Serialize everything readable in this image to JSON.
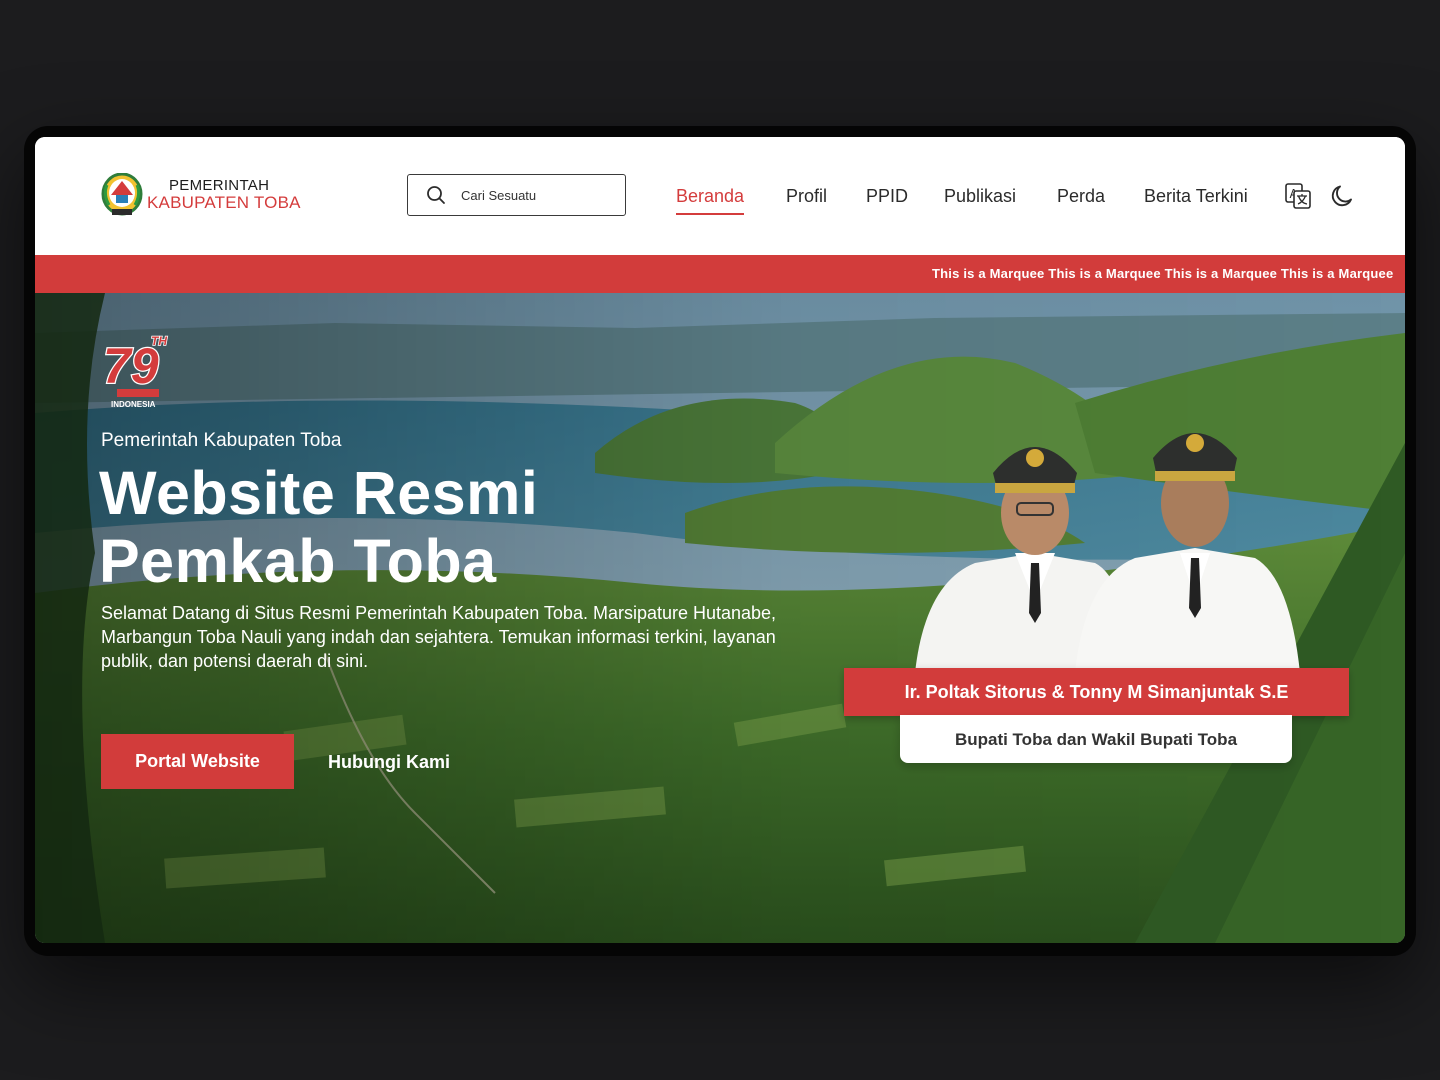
{
  "header": {
    "logo_line1": "PEMERINTAH",
    "logo_line2": "KABUPATEN TOBA",
    "search_placeholder": "Cari Sesuatu",
    "nav": [
      {
        "label": "Beranda",
        "active": true
      },
      {
        "label": "Profil"
      },
      {
        "label": "PPID"
      },
      {
        "label": "Publikasi"
      },
      {
        "label": "Perda"
      },
      {
        "label": "Berita Terkini"
      }
    ],
    "icons": [
      "translate-icon",
      "moon-icon"
    ]
  },
  "marquee": {
    "text": "This is a Marquee This is a Marquee This is a Marquee This is a Marquee"
  },
  "hero": {
    "badge_number": "79",
    "badge_suffix": "TH",
    "badge_country": "INDONESIA",
    "subtitle": "Pemerintah Kabupaten Toba",
    "title_line1": "Website Resmi",
    "title_line2": "Pemkab Toba",
    "description": "Selamat Datang di Situs Resmi Pemerintah Kabupaten Toba. Marsipature Hutanabe, Marbangun Toba Nauli yang indah dan sejahtera. Temukan informasi terkini, layanan publik, dan potensi daerah di sini.",
    "primary_button": "Portal Website",
    "secondary_link": "Hubungi Kami",
    "leaders_name": "Ir. Poltak Sitorus & Tonny M Simanjuntak S.E",
    "leaders_role": "Bupati Toba dan Wakil Bupati Toba"
  },
  "colors": {
    "accent": "#d23c3b",
    "background": "#1c1c1e",
    "device": "#050505"
  }
}
